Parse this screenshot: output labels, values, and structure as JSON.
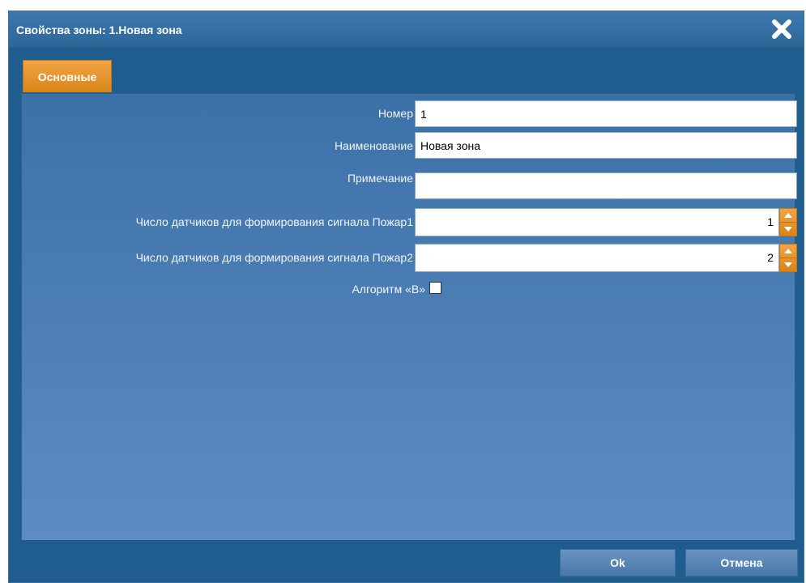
{
  "window": {
    "title": "Свойства зоны: 1.Новая зона",
    "close_icon": "close-icon"
  },
  "tabs": [
    {
      "label": "Основные",
      "active": true
    }
  ],
  "form": {
    "number": {
      "label": "Номер",
      "value": "1"
    },
    "name": {
      "label": "Наименование",
      "value": "Новая зона"
    },
    "note": {
      "label": "Примечание",
      "value": ""
    },
    "fire1": {
      "label": "Число датчиков для формирования сигнала Пожар1",
      "value": "1"
    },
    "fire2": {
      "label": "Число датчиков для формирования сигнала Пожар2",
      "value": "2"
    },
    "algorithm": {
      "label": "Алгоритм «В»",
      "checked": false
    }
  },
  "buttons": {
    "ok": "Ok",
    "cancel": "Отмена"
  },
  "colors": {
    "accent": "#e8952b",
    "dialog_bg": "#1f5d8f",
    "content_top": "#3c71a8",
    "content_bottom": "#5c8cc3"
  }
}
